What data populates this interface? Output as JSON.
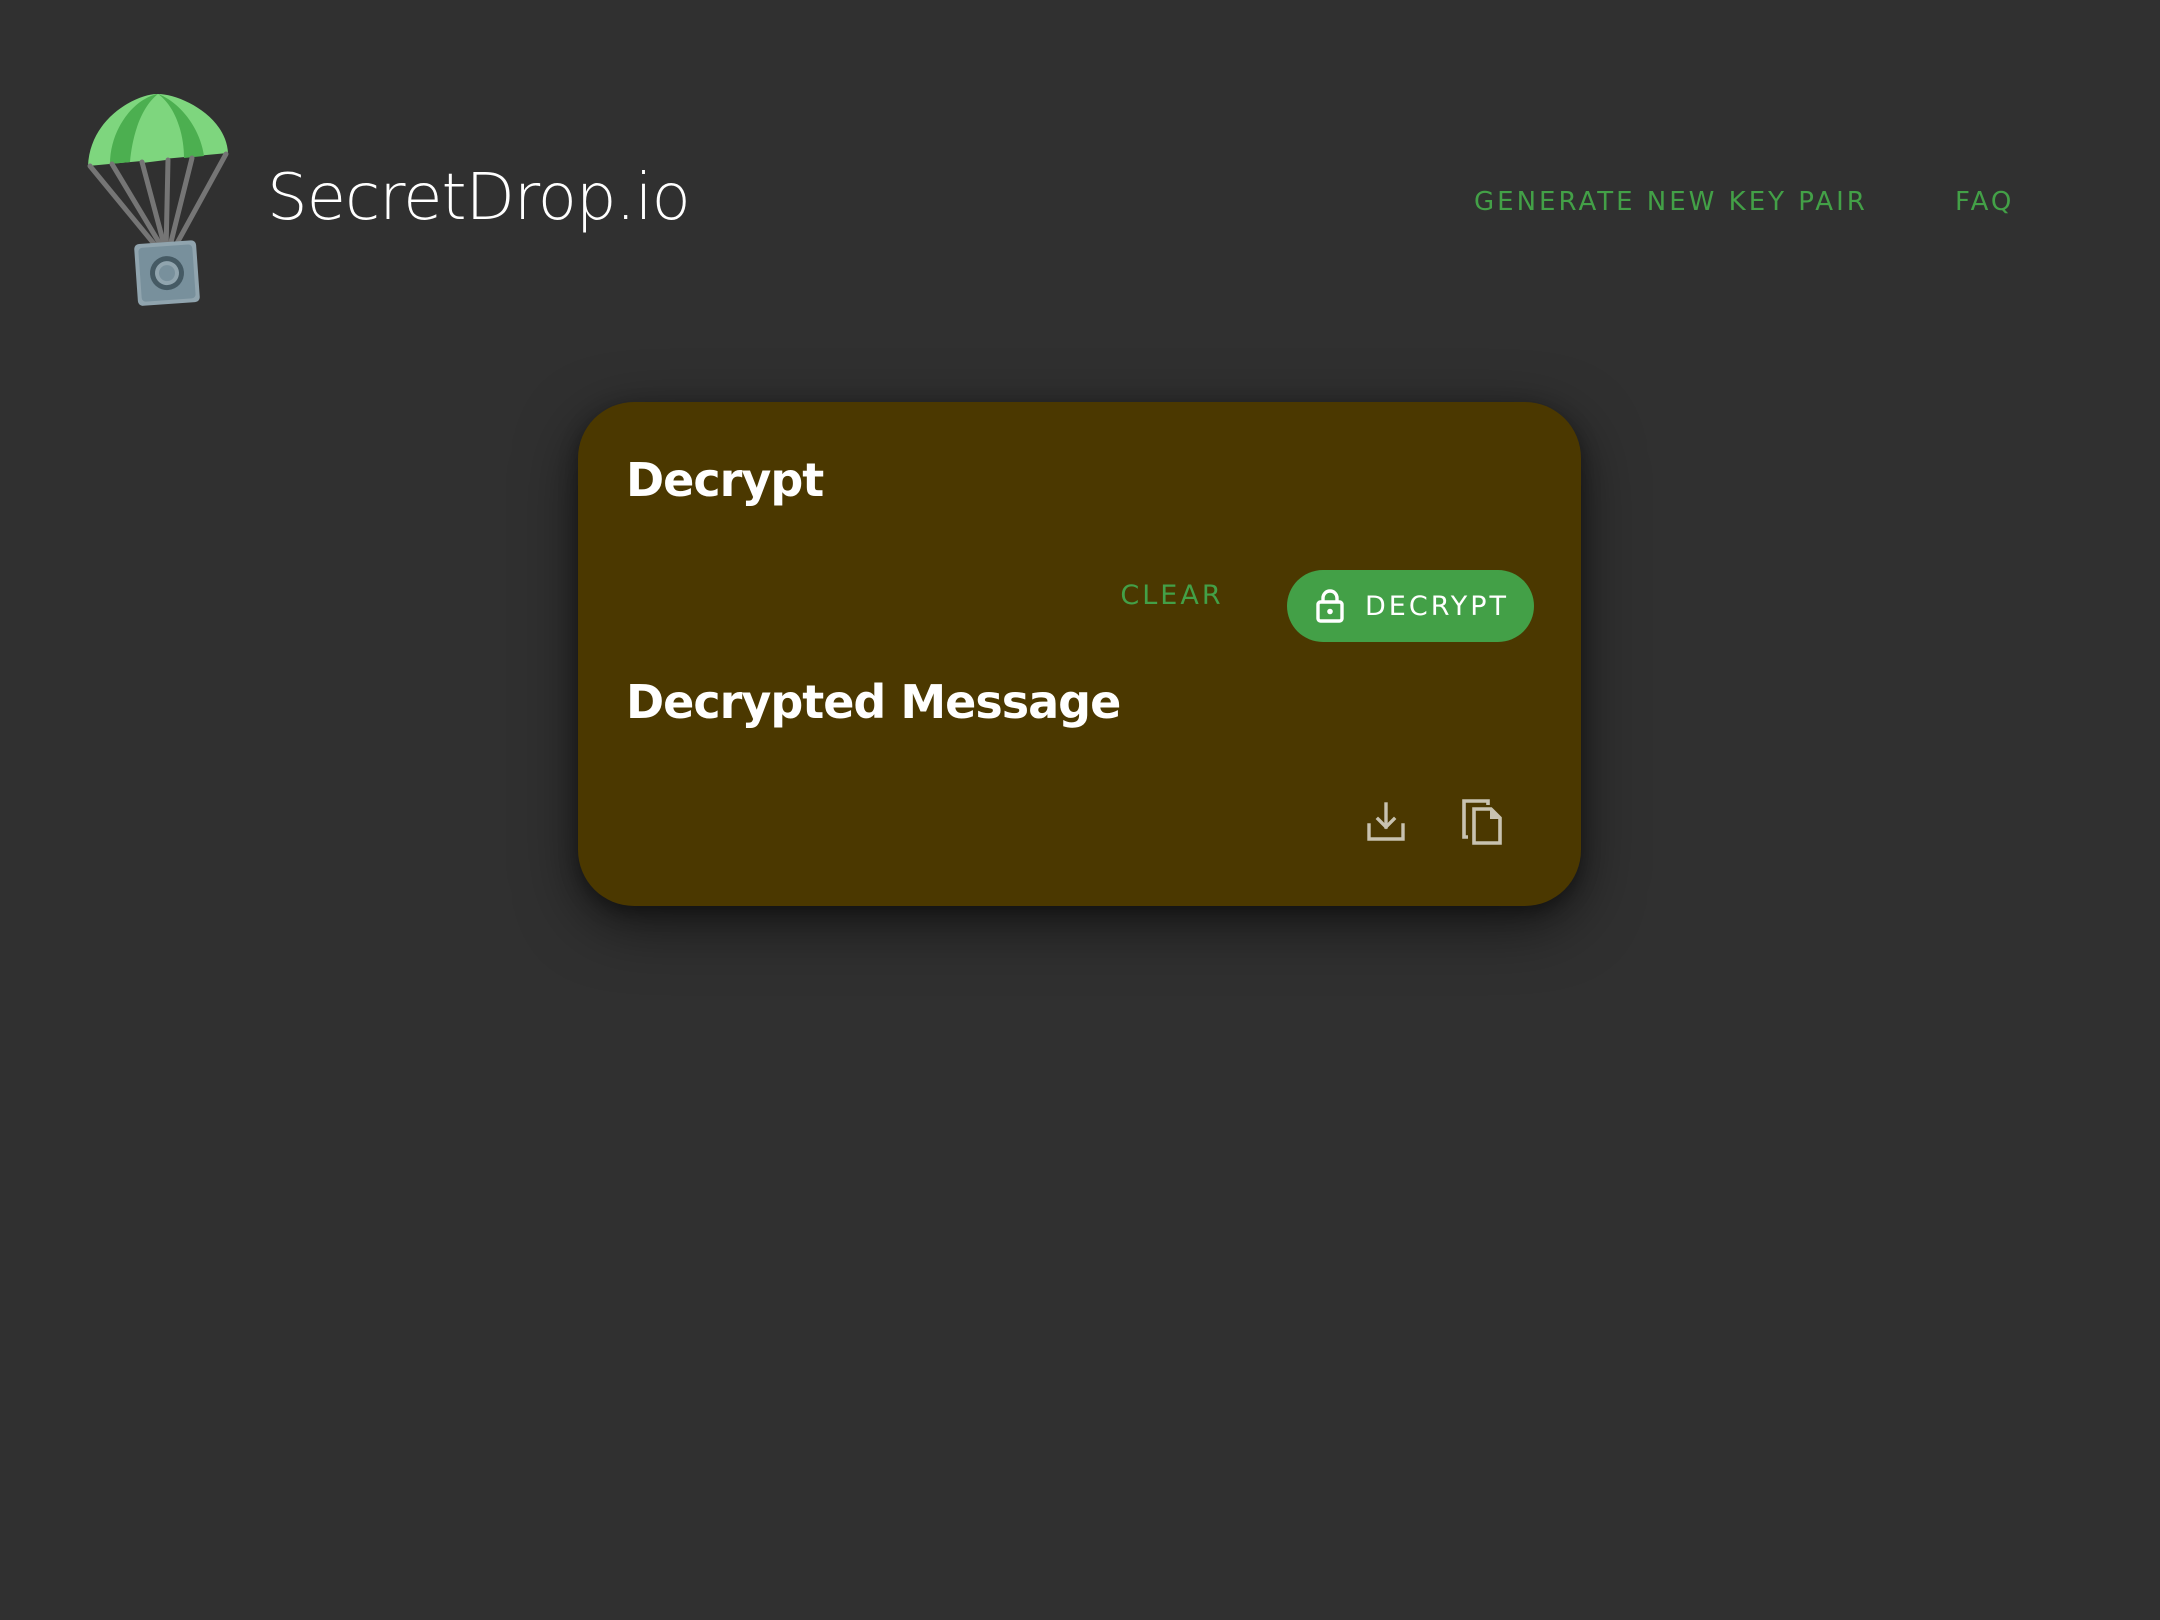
{
  "header": {
    "app_title": "SecretDrop.io",
    "nav": {
      "generate_label": "GENERATE NEW KEY PAIR",
      "faq_label": "FAQ"
    }
  },
  "card": {
    "decrypt_heading": "Decrypt",
    "clear_label": "CLEAR",
    "decrypt_label": "DECRYPT",
    "decrypted_heading": "Decrypted Message",
    "icons": {
      "download": "download-icon",
      "copy": "copy-icon",
      "lock": "lock-icon",
      "logo": "parachute-safe-logo"
    }
  },
  "colors": {
    "background": "#303030",
    "card": "#4b3800",
    "accent": "#43a047",
    "icon": "#c8c2b0"
  }
}
